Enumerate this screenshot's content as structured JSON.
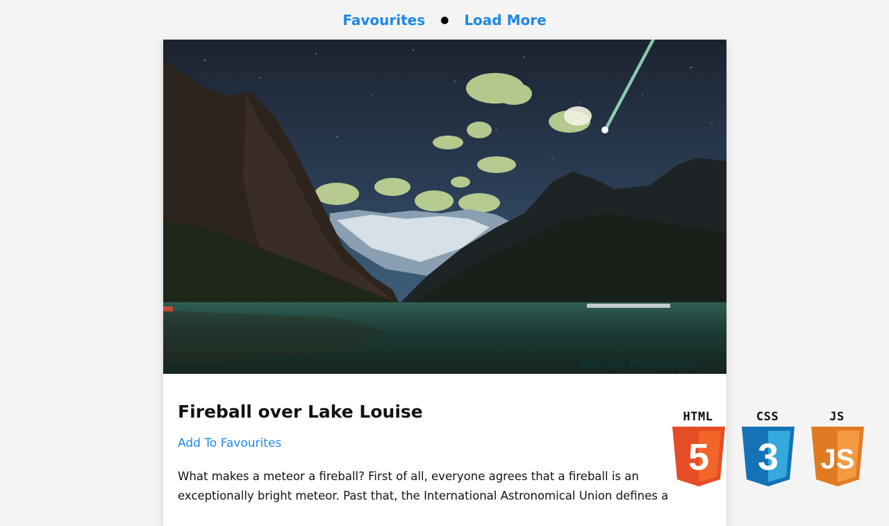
{
  "nav": {
    "favourites_label": "Favourites",
    "separator": "●",
    "load_more_label": "Load More"
  },
  "post": {
    "image_watermark": "Hao Qin Photography",
    "title": "Fireball over Lake Louise",
    "add_favourite_label": "Add To Favourites",
    "description": "What makes a meteor a fireball? First of all, everyone agrees that a fireball is an exceptionally bright meteor. Past that, the International Astronomical Union defines a"
  },
  "badges": [
    {
      "label": "HTML",
      "numeral": "5",
      "color": "#e44d26",
      "icon": "html5-icon"
    },
    {
      "label": "CSS",
      "numeral": "3",
      "color": "#1572b6",
      "icon": "css3-icon"
    },
    {
      "label": "JS",
      "numeral": "JS",
      "color": "#f0872e",
      "icon": "js-icon"
    }
  ],
  "colors": {
    "accent": "#1e88e5",
    "page_background": "#f4f4f4"
  }
}
